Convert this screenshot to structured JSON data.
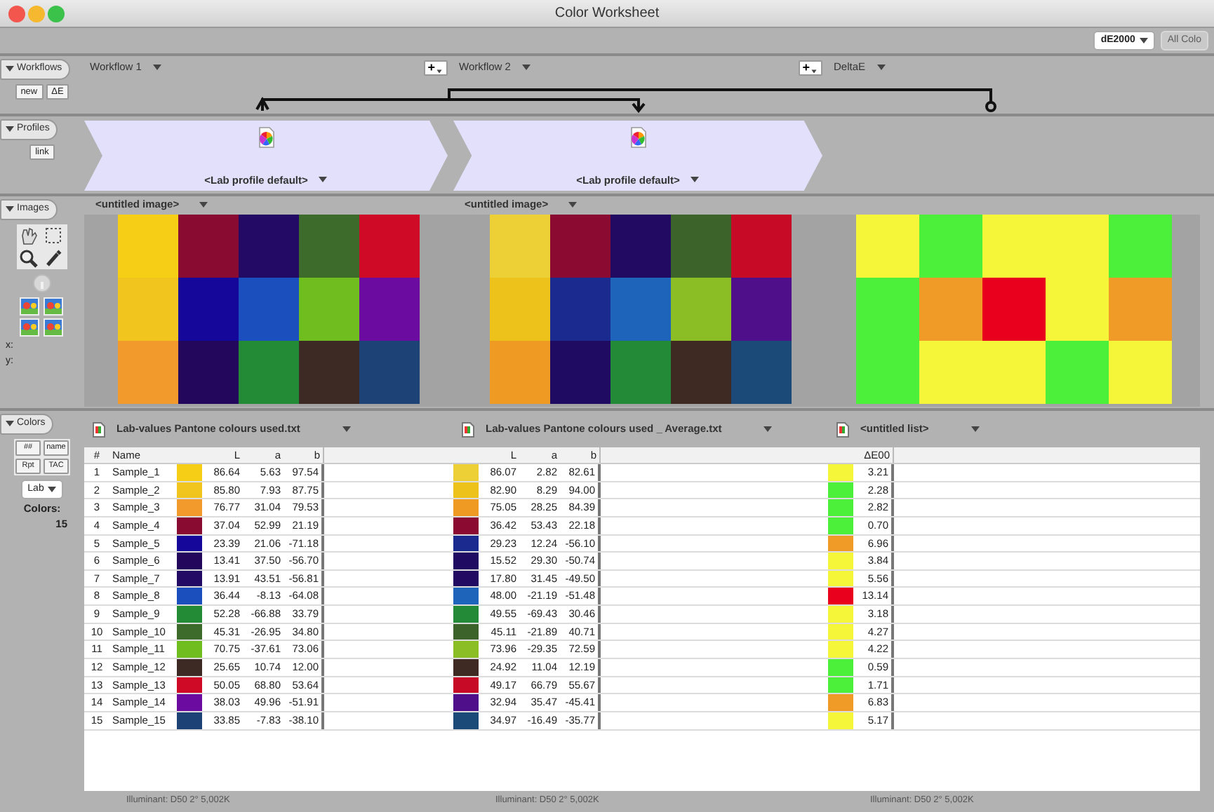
{
  "window": {
    "title": "Color Worksheet"
  },
  "toolbar": {
    "metric": "dE2000",
    "all_colors": {
      "label": "All Colo",
      "disabled": true
    }
  },
  "workflows": {
    "tab": "Workflows",
    "expanded": true,
    "buttons": [
      "new",
      "ΔE"
    ],
    "columns": [
      {
        "label": "Workflow 1",
        "add_label": "+"
      },
      {
        "label": "Workflow 2",
        "add_label": "+"
      },
      {
        "label": "DeltaE"
      }
    ]
  },
  "profiles": {
    "tab": "Profiles",
    "expanded": true,
    "buttons": [
      "link"
    ],
    "items": [
      {
        "label": "<Lab profile default>"
      },
      {
        "label": "<Lab profile default>"
      }
    ]
  },
  "images": {
    "tab": "Images",
    "expanded": true,
    "coord_labels": [
      "x:",
      "y:"
    ],
    "panels": [
      {
        "kind": "image",
        "label": "<untitled image>"
      },
      {
        "kind": "image",
        "label": "<untitled image>"
      },
      {
        "kind": "delta_map"
      }
    ]
  },
  "colors": {
    "tab": "Colors",
    "expanded": true,
    "buttons": [
      "##",
      "name",
      "Rpt",
      "TAC"
    ],
    "space": "Lab",
    "count_label": "Colors:",
    "count": "15"
  },
  "lists": [
    {
      "title": "Lab-values Pantone colours used.txt",
      "footer": "Illuminant: D50 2° 5,002K",
      "columns": [
        {
          "kind": "index",
          "label": "#"
        },
        {
          "kind": "name",
          "label": "Name"
        },
        {
          "kind": "number",
          "label": "L"
        },
        {
          "kind": "number",
          "label": "a"
        },
        {
          "kind": "number",
          "label": "b"
        }
      ],
      "rows": [
        {
          "color": "#f6ce16",
          "cells": [
            "1",
            "Sample_1",
            "86.64",
            "5.63",
            "97.54"
          ]
        },
        {
          "color": "#f2c51e",
          "cells": [
            "2",
            "Sample_2",
            "85.80",
            "7.93",
            "87.75"
          ]
        },
        {
          "color": "#f39a2c",
          "cells": [
            "3",
            "Sample_3",
            "76.77",
            "31.04",
            "79.53"
          ]
        },
        {
          "color": "#8a0b32",
          "cells": [
            "4",
            "Sample_4",
            "37.04",
            "52.99",
            "21.19"
          ]
        },
        {
          "color": "#15079a",
          "cells": [
            "5",
            "Sample_5",
            "23.39",
            "21.06",
            "-71.18"
          ]
        },
        {
          "color": "#22075c",
          "cells": [
            "6",
            "Sample_6",
            "13.41",
            "37.50",
            "-56.70"
          ]
        },
        {
          "color": "#220a65",
          "cells": [
            "7",
            "Sample_7",
            "13.91",
            "43.51",
            "-56.81"
          ]
        },
        {
          "color": "#1a4fbd",
          "cells": [
            "8",
            "Sample_8",
            "36.44",
            "-8.13",
            "-64.08"
          ]
        },
        {
          "color": "#238a35",
          "cells": [
            "9",
            "Sample_9",
            "52.28",
            "-66.88",
            "33.79"
          ]
        },
        {
          "color": "#3d6b2b",
          "cells": [
            "10",
            "Sample_10",
            "45.31",
            "-26.95",
            "34.80"
          ]
        },
        {
          "color": "#70bd1f",
          "cells": [
            "11",
            "Sample_11",
            "70.75",
            "-37.61",
            "73.06"
          ]
        },
        {
          "color": "#3e2a24",
          "cells": [
            "12",
            "Sample_12",
            "25.65",
            "10.74",
            "12.00"
          ]
        },
        {
          "color": "#cf0a26",
          "cells": [
            "13",
            "Sample_13",
            "50.05",
            "68.80",
            "53.64"
          ]
        },
        {
          "color": "#6b0ba0",
          "cells": [
            "14",
            "Sample_14",
            "38.03",
            "49.96",
            "-51.91"
          ]
        },
        {
          "color": "#1c4276",
          "cells": [
            "15",
            "Sample_15",
            "33.85",
            "-7.83",
            "-38.10"
          ]
        }
      ]
    },
    {
      "title": "Lab-values Pantone colours used _ Average.txt",
      "footer": "Illuminant: D50 2° 5,002K",
      "columns": [
        {
          "kind": "number",
          "label": "L"
        },
        {
          "kind": "number",
          "label": "a"
        },
        {
          "kind": "number",
          "label": "b"
        }
      ],
      "rows": [
        {
          "color": "#ecd036",
          "cells": [
            "86.07",
            "2.82",
            "82.61"
          ]
        },
        {
          "color": "#edc21b",
          "cells": [
            "82.90",
            "8.29",
            "94.00"
          ]
        },
        {
          "color": "#ef9a23",
          "cells": [
            "75.05",
            "28.25",
            "84.39"
          ]
        },
        {
          "color": "#8b0a31",
          "cells": [
            "36.42",
            "53.43",
            "22.18"
          ]
        },
        {
          "color": "#1b2a8f",
          "cells": [
            "29.23",
            "12.24",
            "-56.10"
          ]
        },
        {
          "color": "#1f0b61",
          "cells": [
            "15.52",
            "29.30",
            "-50.74"
          ]
        },
        {
          "color": "#220a63",
          "cells": [
            "17.80",
            "31.45",
            "-49.50"
          ]
        },
        {
          "color": "#1f64bb",
          "cells": [
            "48.00",
            "-21.19",
            "-51.48"
          ]
        },
        {
          "color": "#238a37",
          "cells": [
            "49.55",
            "-69.43",
            "30.46"
          ]
        },
        {
          "color": "#3b632a",
          "cells": [
            "45.11",
            "-21.89",
            "40.71"
          ]
        },
        {
          "color": "#8bbd25",
          "cells": [
            "73.96",
            "-29.35",
            "72.59"
          ]
        },
        {
          "color": "#3e2a22",
          "cells": [
            "24.92",
            "11.04",
            "12.19"
          ]
        },
        {
          "color": "#c70a26",
          "cells": [
            "49.17",
            "66.79",
            "55.67"
          ]
        },
        {
          "color": "#4f0f8a",
          "cells": [
            "32.94",
            "35.47",
            "-45.41"
          ]
        },
        {
          "color": "#1b4a78",
          "cells": [
            "34.97",
            "-16.49",
            "-35.77"
          ]
        }
      ]
    },
    {
      "title": "<untitled list>",
      "footer": "Illuminant: D50 2° 5,002K",
      "columns": [
        {
          "kind": "number",
          "label": "ΔE00"
        }
      ],
      "rows": [
        {
          "color": "#f5f53a",
          "cells": [
            "3.21"
          ]
        },
        {
          "color": "#4cf03a",
          "cells": [
            "2.28"
          ]
        },
        {
          "color": "#4cf03a",
          "cells": [
            "2.82"
          ]
        },
        {
          "color": "#4cf03a",
          "cells": [
            "0.70"
          ]
        },
        {
          "color": "#f09a28",
          "cells": [
            "6.96"
          ]
        },
        {
          "color": "#f5f53a",
          "cells": [
            "3.84"
          ]
        },
        {
          "color": "#f5f53a",
          "cells": [
            "5.56"
          ]
        },
        {
          "color": "#e8001c",
          "cells": [
            "13.14"
          ]
        },
        {
          "color": "#f5f53a",
          "cells": [
            "3.18"
          ]
        },
        {
          "color": "#f5f53a",
          "cells": [
            "4.27"
          ]
        },
        {
          "color": "#f5f53a",
          "cells": [
            "4.22"
          ]
        },
        {
          "color": "#4cf03a",
          "cells": [
            "0.59"
          ]
        },
        {
          "color": "#4cf03a",
          "cells": [
            "1.71"
          ]
        },
        {
          "color": "#f09a28",
          "cells": [
            "6.83"
          ]
        },
        {
          "color": "#f5f53a",
          "cells": [
            "5.17"
          ]
        }
      ]
    }
  ]
}
